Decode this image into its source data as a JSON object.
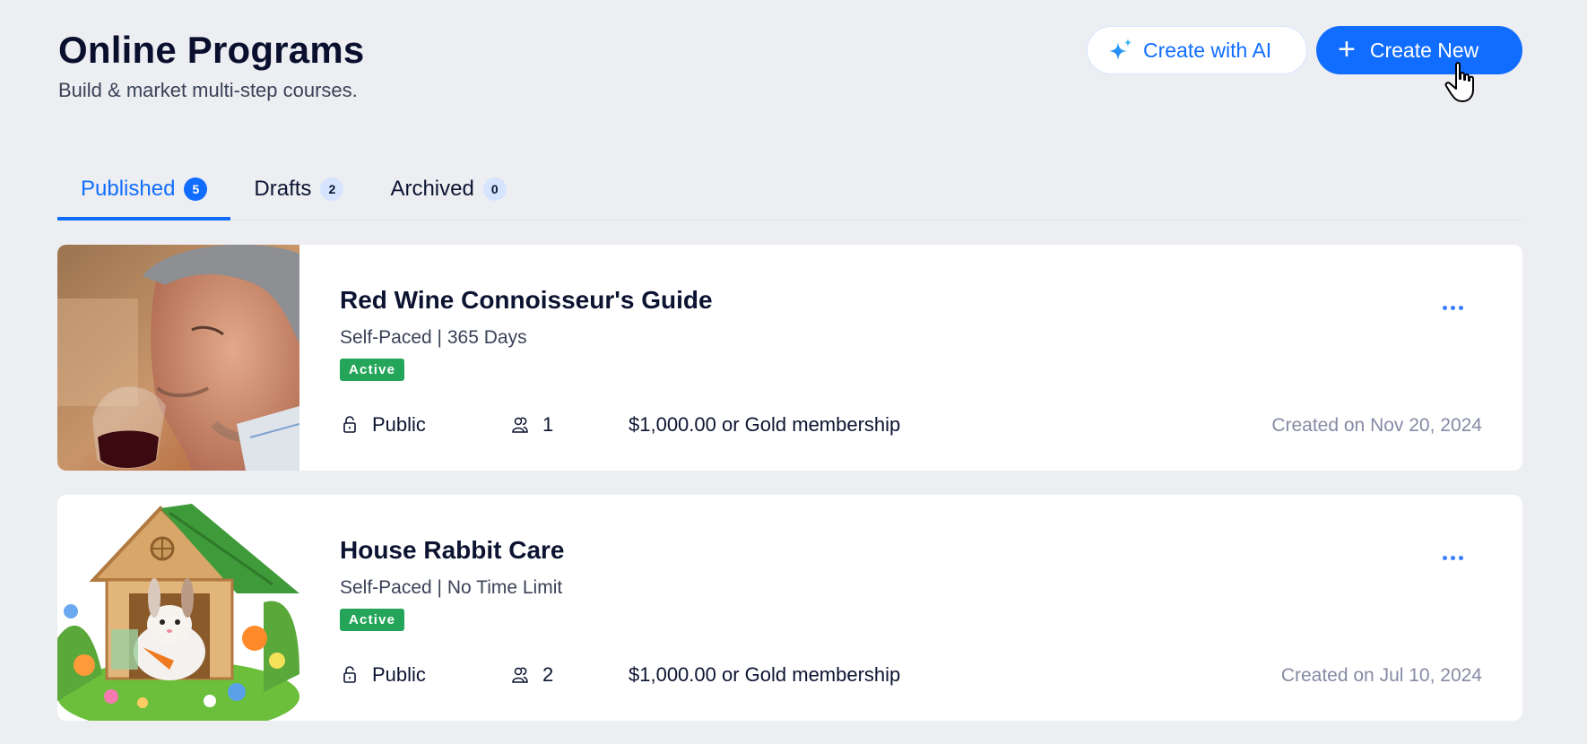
{
  "header": {
    "title": "Online Programs",
    "subtitle": "Build & market multi-step courses."
  },
  "actions": {
    "create_ai_label": "Create with AI",
    "create_new_label": "Create New"
  },
  "tabs": [
    {
      "label": "Published",
      "count": "5",
      "active": true
    },
    {
      "label": "Drafts",
      "count": "2",
      "active": false
    },
    {
      "label": "Archived",
      "count": "0",
      "active": false
    }
  ],
  "programs": [
    {
      "title": "Red Wine Connoisseur's Guide",
      "meta": "Self-Paced | 365 Days",
      "status": "Active",
      "visibility": "Public",
      "participants": "1",
      "price": "$1,000.00 or Gold membership",
      "created": "Created on Nov 20, 2024",
      "image": "man-smelling-red-wine-photo"
    },
    {
      "title": "House Rabbit Care",
      "meta": "Self-Paced | No Time Limit",
      "status": "Active",
      "visibility": "Public",
      "participants": "2",
      "price": "$1,000.00 or Gold membership",
      "created": "Created on Jul 10, 2024",
      "image": "rabbit-in-wooden-house-illustration"
    }
  ],
  "colors": {
    "accent": "#116dff",
    "status_active": "#25a55a",
    "background": "#eceef2"
  }
}
